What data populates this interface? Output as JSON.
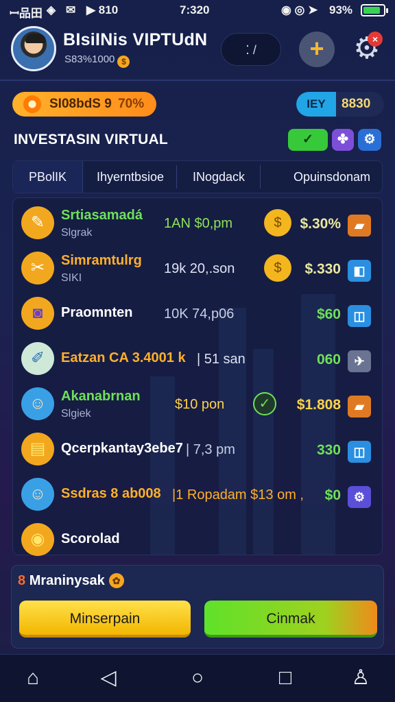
{
  "status_bar": {
    "left_text": "ꟷ品田",
    "net_text": "◈",
    "mail_text": "✉",
    "extra_text": "▶ 810",
    "time": "7:320",
    "right_icons": "◉ ◎ ➤",
    "battery_text": "93%"
  },
  "header": {
    "app_title": "BIsiINis VIPTUdN",
    "balance_text": "S83%1000",
    "search_glyph": "⁚ /",
    "add_glyph": "+",
    "settings_glyph": "⚙",
    "notification_glyph": "×"
  },
  "level": {
    "label": "SI08bdS 9",
    "percent": "70%"
  },
  "currency": {
    "code": "IEY",
    "value": "8830"
  },
  "section": {
    "title": "INVESTASIN VIRTUAL",
    "check_glyph": "✓",
    "puzzle_glyph": "✤",
    "gear_glyph": "⚙"
  },
  "tabs": [
    {
      "label": "PBolIK"
    },
    {
      "label": "Ihyerntbsioe"
    },
    {
      "label": "INogdack"
    },
    {
      "label": "Opuinsdonam"
    }
  ],
  "rows": [
    {
      "name": "Srtiasamadá",
      "sub": "Slgrak",
      "mid": "1AN $0,pm",
      "price": "$.30%",
      "name_color": "#6fe05a",
      "mid_color": "#8fe25a",
      "price_color": "#e9e9a0",
      "icon_glyph": "✎",
      "icon_bg": "#f2a81e",
      "badge_glyph": "$",
      "badge_bg": "#f3b61f",
      "action_glyph": "▰",
      "action_bg": "#e07a22"
    },
    {
      "name": "Simramtulrg",
      "sub": "SIKI",
      "mid": "19k 20,.son",
      "price": "$.330",
      "name_color": "#ffb02a",
      "mid_color": "#dfe3f2",
      "price_color": "#e9e9a0",
      "icon_glyph": "✂",
      "icon_bg": "#f2a81e",
      "badge_glyph": "$",
      "badge_bg": "#f3b61f",
      "action_glyph": "◧",
      "action_bg": "#2a8fe0"
    },
    {
      "name": "Praomnten",
      "sub": "",
      "mid": "10K 74,p06",
      "price": "$60",
      "name_color": "#ffffff",
      "mid_color": "#c9cfe6",
      "price_color": "#6fe05a",
      "icon_glyph": "◙",
      "icon_bg": "#f2a81e",
      "badge_glyph": "",
      "badge_bg": "transparent",
      "action_glyph": "◫",
      "action_bg": "#2a8fe0"
    },
    {
      "name": "Eatzan CA 3.4001 k",
      "sub": "",
      "mid": "| 51 san",
      "price": "060",
      "name_color": "#ffb02a",
      "mid_color": "#dfe3f2",
      "price_color": "#6fe05a",
      "icon_glyph": "✐",
      "icon_bg": "#cfe9d9",
      "badge_glyph": "",
      "badge_bg": "transparent",
      "action_glyph": "✈",
      "action_bg": "#6a7391"
    },
    {
      "name": "Akanabrnan",
      "sub": "Slgiek",
      "mid": "$10 pon",
      "price": "$1.808",
      "name_color": "#6fe05a",
      "mid_color": "#ffd34a",
      "price_color": "#ffd34a",
      "icon_glyph": "☺",
      "icon_bg": "#3aa0e6",
      "badge_glyph": "✓",
      "badge_bg": "#1f3a2b",
      "action_glyph": "▰",
      "action_bg": "#e07a22"
    },
    {
      "name": "Qcerpkantay3ebe7",
      "sub": "",
      "mid": "| 7,3 pm",
      "price": "330",
      "name_color": "#ffffff",
      "mid_color": "#c9cfe6",
      "price_color": "#6fe05a",
      "icon_glyph": "▤",
      "icon_bg": "#f2a81e",
      "badge_glyph": "",
      "badge_bg": "transparent",
      "action_glyph": "◫",
      "action_bg": "#2a8fe0"
    },
    {
      "name": "Ssdras 8 ab008",
      "sub": "",
      "mid": "|1 Ropadam $13 om ,",
      "price": "$0",
      "name_color": "#ffb02a",
      "mid_color": "#ffb02a",
      "price_color": "#6fe05a",
      "icon_glyph": "☺",
      "icon_bg": "#3aa0e6",
      "badge_glyph": "",
      "badge_bg": "transparent",
      "action_glyph": "⚙",
      "action_bg": "#5b4fd8"
    },
    {
      "name": "Scorolad",
      "sub": "",
      "mid": "",
      "price": "",
      "name_color": "#ffffff",
      "mid_color": "#ffffff",
      "price_color": "#ffffff",
      "icon_glyph": "◉",
      "icon_bg": "#f2a81e",
      "badge_glyph": "",
      "badge_bg": "transparent",
      "action_glyph": "",
      "action_bg": "transparent"
    }
  ],
  "bottom": {
    "label_prefix": "8",
    "label": "Mraninysak",
    "badge_glyph": "✿",
    "left_button": "Minserpain",
    "right_button": "Cinmak"
  },
  "nav": {
    "home": "⌂",
    "back": "◁",
    "circle": "○",
    "square": "□",
    "profile": "♙"
  }
}
